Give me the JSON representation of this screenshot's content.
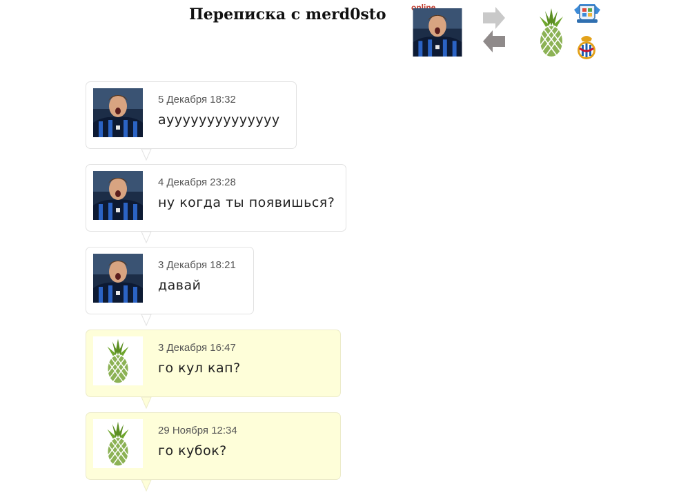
{
  "header": {
    "title": "Переписка с merd0sto",
    "status": "online",
    "partner_avatar_icon": "footballer-avatar-icon",
    "nav_icons": [
      "arrow-right-icon",
      "arrow-left-icon"
    ],
    "user_avatar_icon": "pineapple-icon",
    "badge_icons": [
      "shield-badge-icon",
      "espanyol-crest-icon"
    ]
  },
  "messages": [
    {
      "from": "partner",
      "avatar_icon": "footballer-avatar-icon",
      "date": "5 Декабря 18:32",
      "text": "ауууууууууууууу"
    },
    {
      "from": "partner",
      "avatar_icon": "footballer-avatar-icon",
      "date": "4 Декабря 23:28",
      "text": "ну когда ты появишься?"
    },
    {
      "from": "partner",
      "avatar_icon": "footballer-avatar-icon",
      "date": "3 Декабря 18:21",
      "text": "давай"
    },
    {
      "from": "me",
      "avatar_icon": "pineapple-icon",
      "date": "3 Декабря 16:47",
      "text": "го кул кап?"
    },
    {
      "from": "me",
      "avatar_icon": "pineapple-icon",
      "date": "29 Ноября 12:34",
      "text": "го кубок?"
    }
  ],
  "colors": {
    "partner_bubble": "#ffffff",
    "my_bubble": "#fefed9",
    "online_red": "#c0392b",
    "pineapple_green": "#6b9a2c"
  }
}
